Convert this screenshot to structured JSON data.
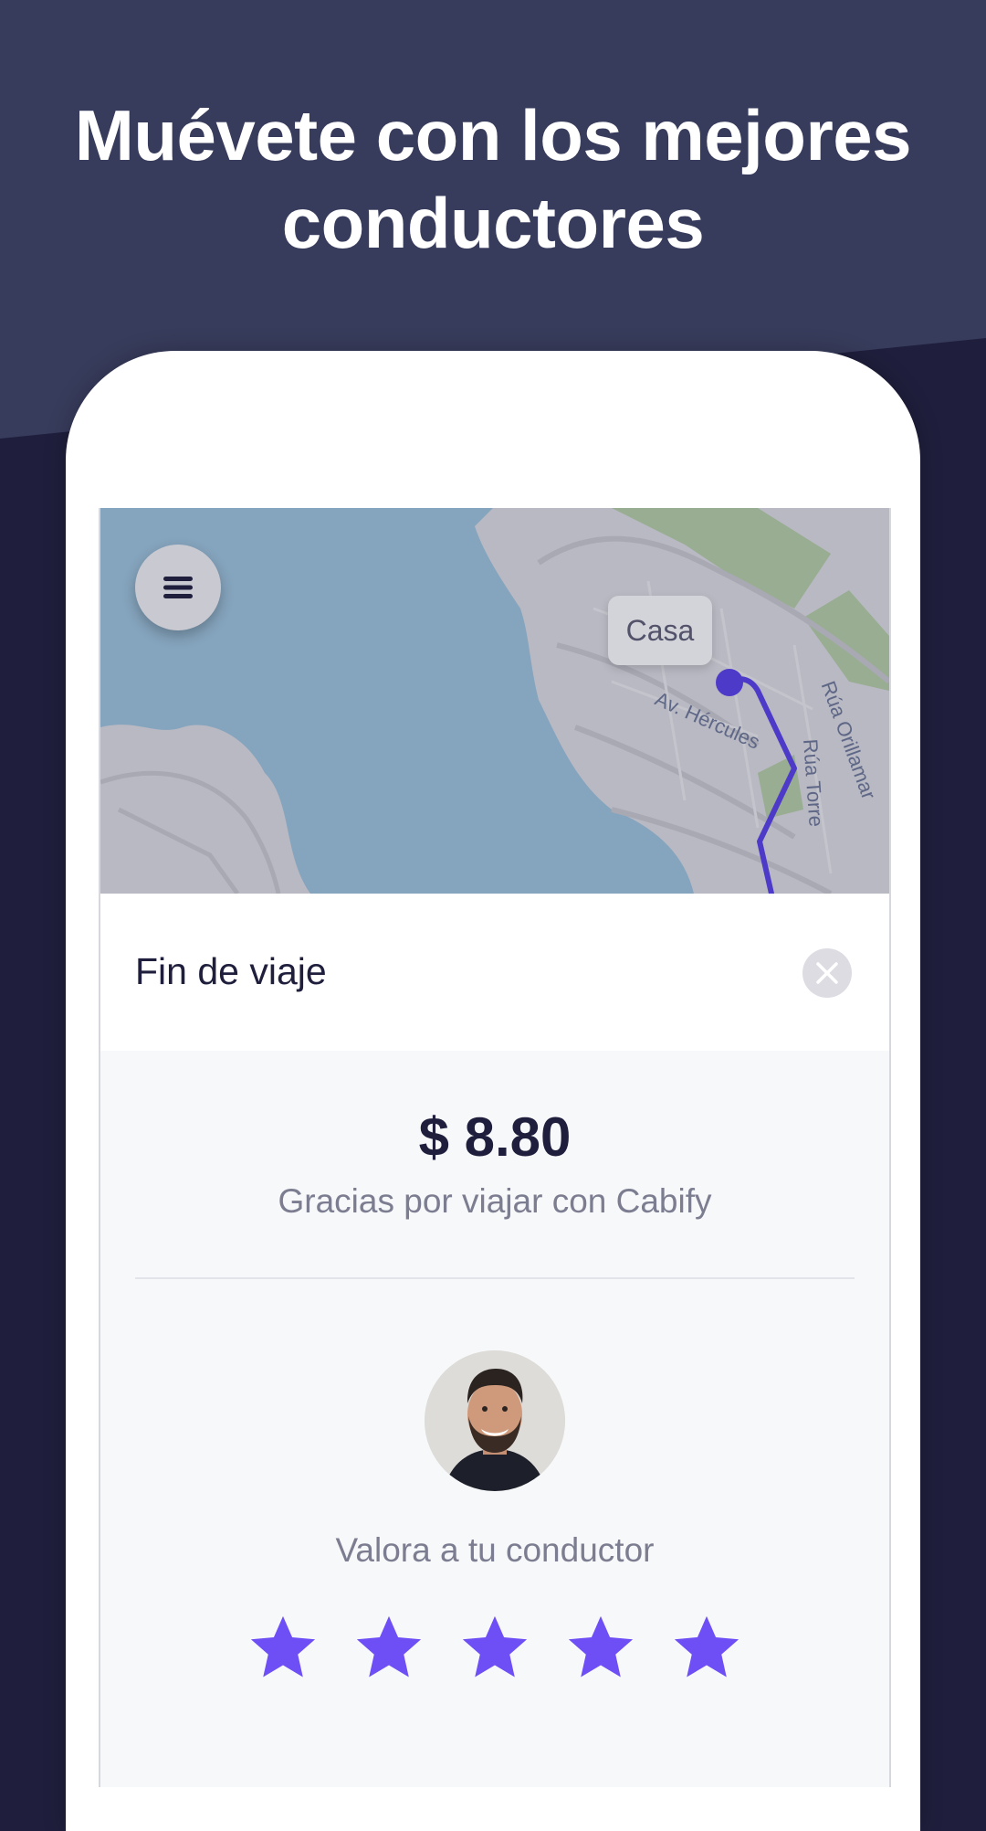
{
  "headline": "Muévete con los mejores conductores",
  "map": {
    "place_label": "Casa",
    "streets": [
      "Av. Hércules",
      "Rúa Orillamar",
      "Rúa Torre"
    ]
  },
  "trip": {
    "title": "Fin de viaje",
    "price": "$ 8.80",
    "thanks": "Gracias por viajar con Cabify"
  },
  "rating": {
    "prompt": "Valora a tu conductor",
    "stars": 5
  },
  "colors": {
    "accent": "#6e4ef5",
    "route": "#4e3ac9",
    "background_dark": "#1f1f3d",
    "background_top": "#383c5c"
  },
  "icons": [
    "menu-icon",
    "close-icon",
    "star-icon",
    "driver-avatar"
  ]
}
